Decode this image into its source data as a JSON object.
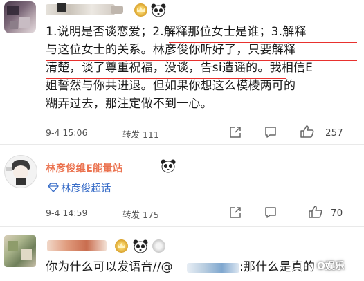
{
  "comment1": {
    "text_line1": "1.说明是否谈恋爱；2.解释那位女士是谁；3.解释",
    "text_line2": "与这位女士的关系。林彦俊你听好了，只要解释",
    "text_line3": "清楚，谈了尊重祝福，没谈，告si造谣的。我相信E",
    "text_line4": "姐誓然与你共进退。但如果你想这么模棱两可的",
    "text_line5": "糊弄过去，那注定做不到一心。",
    "time": "9-4 15:06",
    "repost_label": "转发 111",
    "likes": "257"
  },
  "comment2": {
    "username": "林彦俊维E能量站",
    "topic": "林彦俊超话",
    "time": "9-4 14:59",
    "repost_label": "转发 175",
    "likes": "70"
  },
  "comment3": {
    "text_start": "你为什么可以发语音//@",
    "text_end": ":那什么是真的",
    "watermark": "O娱乐"
  },
  "colors": {
    "underline": "#e8312e",
    "username": "#eb7350",
    "topic": "#3a6ec8"
  }
}
